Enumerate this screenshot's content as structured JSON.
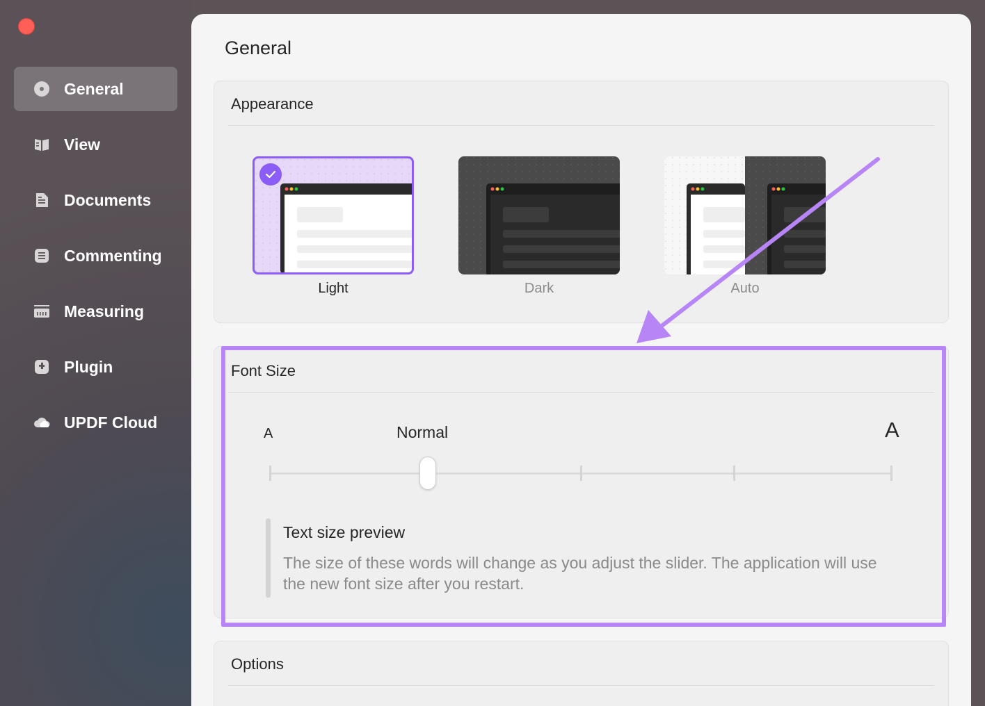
{
  "sidebar": {
    "items": [
      {
        "label": "General",
        "icon": "general-icon",
        "active": true
      },
      {
        "label": "View",
        "icon": "view-icon",
        "active": false
      },
      {
        "label": "Documents",
        "icon": "documents-icon",
        "active": false
      },
      {
        "label": "Commenting",
        "icon": "commenting-icon",
        "active": false
      },
      {
        "label": "Measuring",
        "icon": "measuring-icon",
        "active": false
      },
      {
        "label": "Plugin",
        "icon": "plugin-icon",
        "active": false
      },
      {
        "label": "UPDF Cloud",
        "icon": "cloud-icon",
        "active": false
      }
    ]
  },
  "page": {
    "title": "General"
  },
  "appearance": {
    "title": "Appearance",
    "options": [
      {
        "label": "Light",
        "selected": true
      },
      {
        "label": "Dark",
        "selected": false
      },
      {
        "label": "Auto",
        "selected": false
      }
    ]
  },
  "font_size": {
    "title": "Font Size",
    "small_label": "A",
    "large_label": "A",
    "current_label": "Normal",
    "slider_steps": 5,
    "slider_value_index": 1,
    "preview_title": "Text size preview",
    "preview_text": "The size of these words will change as you adjust the slider. The application will use the new font size after you restart."
  },
  "options": {
    "title": "Options"
  },
  "colors": {
    "accent": "#8b5cf6",
    "highlight": "#b785f6",
    "sidebar_bg": "#5a5256",
    "close": "#ff5f57"
  }
}
